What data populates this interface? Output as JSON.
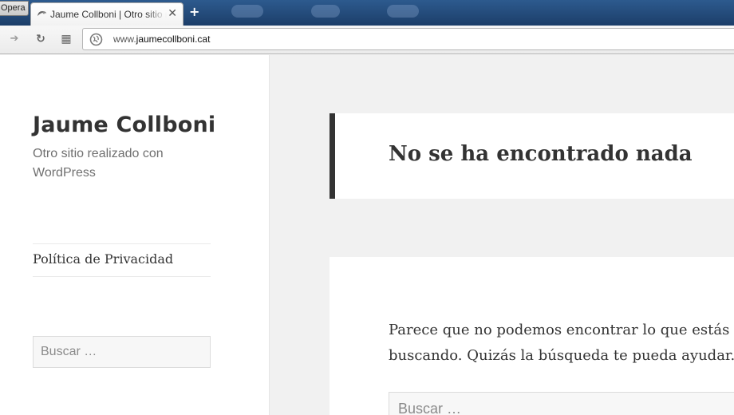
{
  "browser": {
    "menu_button_label": "Opera",
    "tab": {
      "title": "Jaume Collboni | Otro sitio realizado con WordPress",
      "close_glyph": "✕"
    },
    "new_tab_glyph": "+",
    "toolbar": {
      "forward_glyph": "➔",
      "reload_glyph": "↻",
      "speed_dial_glyph": "▦"
    },
    "address": {
      "prefix": "www.",
      "host": "jaumecollboni",
      "suffix": ".cat"
    }
  },
  "sidebar": {
    "site_title": "Jaume Collboni",
    "site_description": "Otro sitio realizado con WordPress",
    "nav_items": [
      {
        "label": "Política de Privacidad"
      }
    ],
    "search": {
      "placeholder": "Buscar …"
    }
  },
  "main": {
    "page_title": "No se ha encontrado nada",
    "content_text": "Parece que no podemos encontrar lo que estás buscando. Quizás la búsqueda te pueda ayudar.",
    "search": {
      "placeholder": "Buscar …"
    }
  },
  "colors": {
    "tab_bar": "#1c3e69",
    "page_background": "#f1f1f1",
    "header_accent": "#333333"
  }
}
